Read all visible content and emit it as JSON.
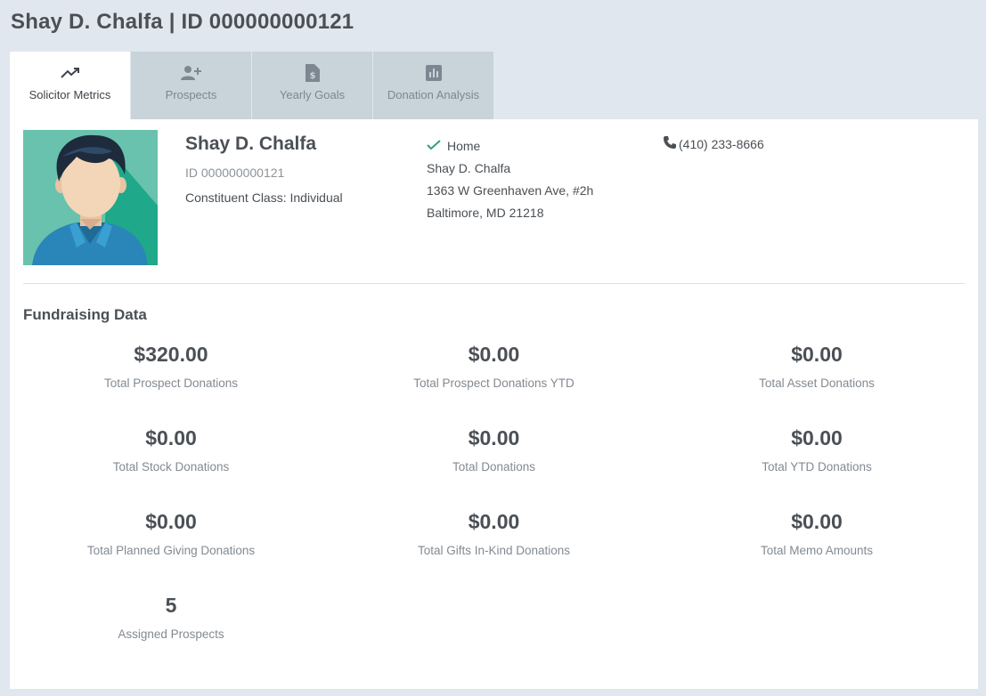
{
  "header": {
    "title": "Shay D. Chalfa | ID 000000000121"
  },
  "tabs": [
    {
      "label": "Solicitor Metrics",
      "icon": "trending-up-icon",
      "active": true
    },
    {
      "label": "Prospects",
      "icon": "add-user-icon",
      "active": false
    },
    {
      "label": "Yearly Goals",
      "icon": "dollar-document-icon",
      "active": false
    },
    {
      "label": "Donation Analysis",
      "icon": "bar-chart-icon",
      "active": false
    }
  ],
  "profile": {
    "name": "Shay D. Chalfa",
    "id_line": "ID 000000000121",
    "constituent_class": "Constituent Class: Individual",
    "address": {
      "type_label": "Home",
      "line1": "Shay D. Chalfa",
      "line2": "1363 W Greenhaven Ave, #2h",
      "line3": "Baltimore, MD 21218"
    },
    "phone": "(410) 233-8666"
  },
  "fundraising": {
    "title": "Fundraising Data",
    "metrics": [
      {
        "value": "$320.00",
        "label": "Total Prospect Donations"
      },
      {
        "value": "$0.00",
        "label": "Total Prospect Donations YTD"
      },
      {
        "value": "$0.00",
        "label": "Total Asset Donations"
      },
      {
        "value": "$0.00",
        "label": "Total Stock Donations"
      },
      {
        "value": "$0.00",
        "label": "Total Donations"
      },
      {
        "value": "$0.00",
        "label": "Total YTD Donations"
      },
      {
        "value": "$0.00",
        "label": "Total Planned Giving Donations"
      },
      {
        "value": "$0.00",
        "label": "Total Gifts In-Kind Donations"
      },
      {
        "value": "$0.00",
        "label": "Total Memo Amounts"
      },
      {
        "value": "5",
        "label": "Assigned Prospects"
      }
    ]
  },
  "colors": {
    "page_bg": "#e1e7ee",
    "tab_inactive": "#c8d3da",
    "accent_green": "#2ea37a",
    "text_dark": "#4b5056"
  }
}
